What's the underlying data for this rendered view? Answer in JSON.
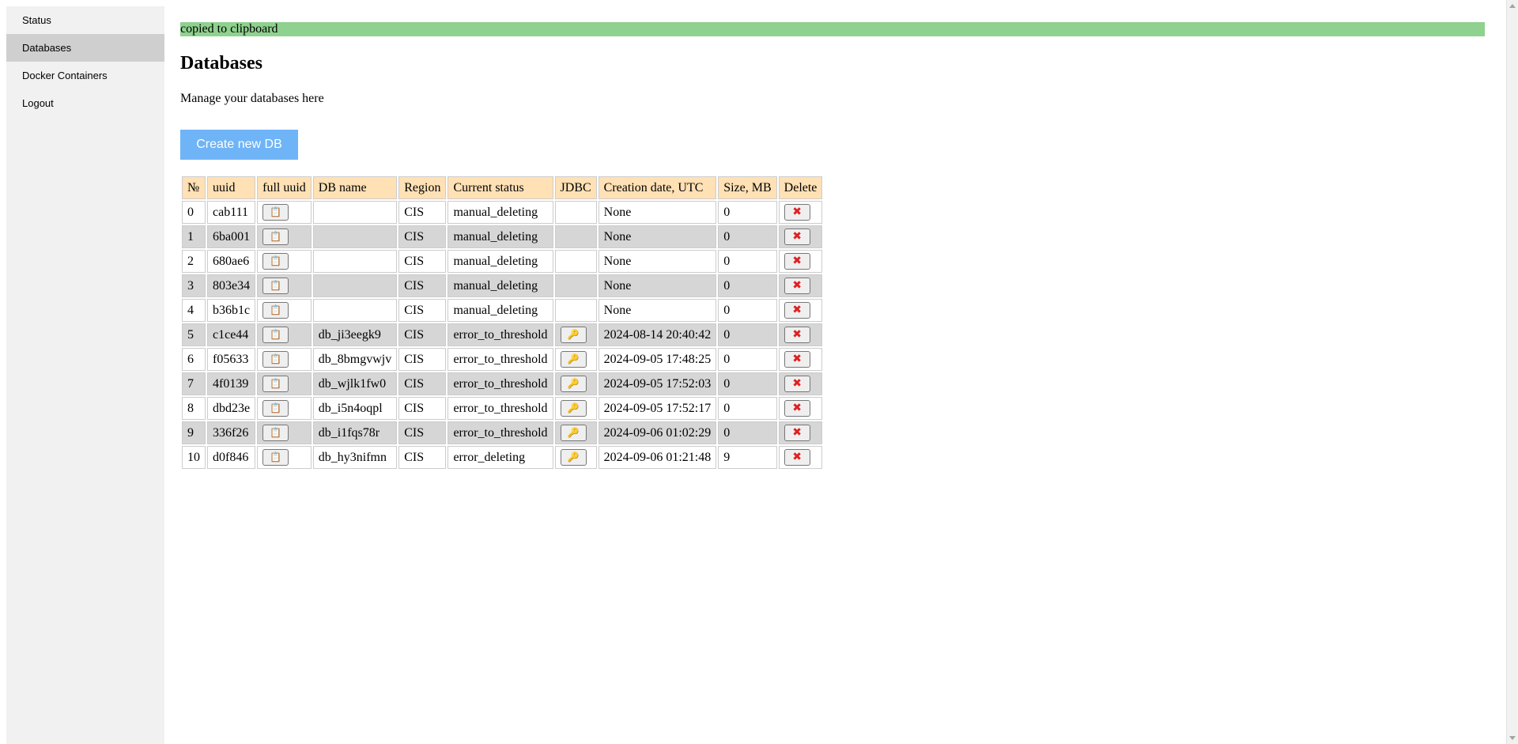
{
  "sidebar": {
    "items": [
      {
        "label": "Status",
        "active": false
      },
      {
        "label": "Databases",
        "active": true
      },
      {
        "label": "Docker Containers",
        "active": false
      },
      {
        "label": "Logout",
        "active": false
      }
    ]
  },
  "notice": "copied to clipboard",
  "page": {
    "title": "Databases",
    "subtitle": "Manage your databases here",
    "create_button": "Create new DB"
  },
  "table": {
    "headers": [
      "№",
      "uuid",
      "full uuid",
      "DB name",
      "Region",
      "Current status",
      "JDBC",
      "Creation date, UTC",
      "Size, MB",
      "Delete"
    ],
    "rows": [
      {
        "n": "0",
        "uuid": "cab111",
        "db_name": "",
        "region": "CIS",
        "status": "manual_deleting",
        "jdbc": false,
        "created": "None",
        "size": "0"
      },
      {
        "n": "1",
        "uuid": "6ba001",
        "db_name": "",
        "region": "CIS",
        "status": "manual_deleting",
        "jdbc": false,
        "created": "None",
        "size": "0"
      },
      {
        "n": "2",
        "uuid": "680ae6",
        "db_name": "",
        "region": "CIS",
        "status": "manual_deleting",
        "jdbc": false,
        "created": "None",
        "size": "0"
      },
      {
        "n": "3",
        "uuid": "803e34",
        "db_name": "",
        "region": "CIS",
        "status": "manual_deleting",
        "jdbc": false,
        "created": "None",
        "size": "0"
      },
      {
        "n": "4",
        "uuid": "b36b1c",
        "db_name": "",
        "region": "CIS",
        "status": "manual_deleting",
        "jdbc": false,
        "created": "None",
        "size": "0"
      },
      {
        "n": "5",
        "uuid": "c1ce44",
        "db_name": "db_ji3eegk9",
        "region": "CIS",
        "status": "error_to_threshold",
        "jdbc": true,
        "created": "2024-08-14 20:40:42",
        "size": "0"
      },
      {
        "n": "6",
        "uuid": "f05633",
        "db_name": "db_8bmgvwjv",
        "region": "CIS",
        "status": "error_to_threshold",
        "jdbc": true,
        "created": "2024-09-05 17:48:25",
        "size": "0"
      },
      {
        "n": "7",
        "uuid": "4f0139",
        "db_name": "db_wjlk1fw0",
        "region": "CIS",
        "status": "error_to_threshold",
        "jdbc": true,
        "created": "2024-09-05 17:52:03",
        "size": "0"
      },
      {
        "n": "8",
        "uuid": "dbd23e",
        "db_name": "db_i5n4oqpl",
        "region": "CIS",
        "status": "error_to_threshold",
        "jdbc": true,
        "created": "2024-09-05 17:52:17",
        "size": "0"
      },
      {
        "n": "9",
        "uuid": "336f26",
        "db_name": "db_i1fqs78r",
        "region": "CIS",
        "status": "error_to_threshold",
        "jdbc": true,
        "created": "2024-09-06 01:02:29",
        "size": "0"
      },
      {
        "n": "10",
        "uuid": "d0f846",
        "db_name": "db_hy3nifmn",
        "region": "CIS",
        "status": "error_deleting",
        "jdbc": true,
        "created": "2024-09-06 01:21:48",
        "size": "9"
      }
    ]
  },
  "icons": {
    "copy": "clipboard-icon",
    "jdbc": "key-icon",
    "delete": "cross-mark-icon"
  },
  "colors": {
    "notice_bg": "#8fd18f",
    "button_bg": "#6fb4f7",
    "header_bg": "#ffe1b5",
    "row_alt_bg": "#d6d6d6",
    "sidebar_bg": "#f1f1f1",
    "sidebar_active_bg": "#cfcfcf"
  }
}
